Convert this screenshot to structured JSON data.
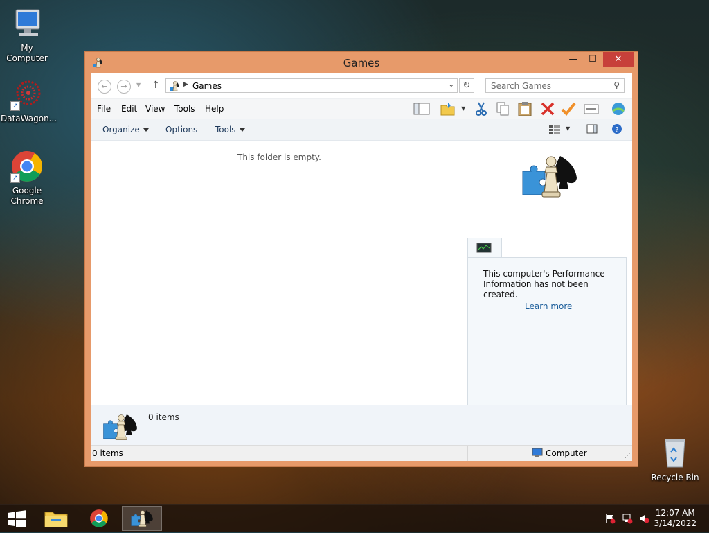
{
  "desktop": {
    "icons": [
      {
        "label": "My Computer"
      },
      {
        "label": "DataWagon..."
      },
      {
        "label": "Google Chrome"
      },
      {
        "label": "Recycle Bin"
      }
    ]
  },
  "window": {
    "title": "Games",
    "controls": {
      "minimize": "—",
      "maximize": "☐",
      "close": "✕"
    },
    "address": {
      "path": "Games"
    },
    "search": {
      "placeholder": "Search Games"
    },
    "menu": [
      "File",
      "Edit",
      "View",
      "Tools",
      "Help"
    ],
    "commands": {
      "organize": "Organize",
      "options": "Options",
      "tools": "Tools"
    },
    "content": {
      "empty_text": "This folder is empty.",
      "perf_text": "This computer's Performance Information has not been created.",
      "learn_more": "Learn more"
    },
    "details": {
      "count": "0 items"
    },
    "status": {
      "left": "0 items",
      "right": "Computer"
    }
  },
  "taskbar": {
    "clock": {
      "time": "12:07 AM",
      "date": "3/14/2022"
    }
  },
  "colors": {
    "titlebar": "#e79a6a",
    "close": "#c7403a",
    "link": "#1a5d9a"
  }
}
